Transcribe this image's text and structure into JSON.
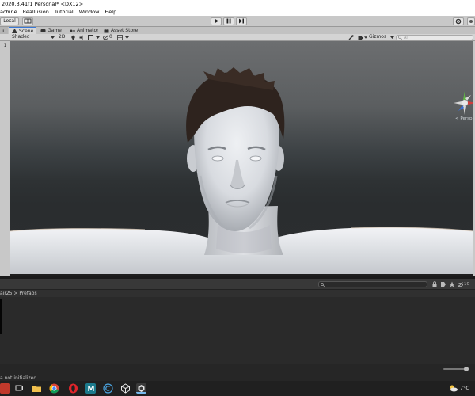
{
  "window": {
    "title": "2020.3.41f1 Personal* <DX12>"
  },
  "menu": {
    "items": [
      "achine",
      "Reallusion",
      "Tutorial",
      "Window",
      "Help"
    ]
  },
  "toolbar": {
    "pivot_label": "Local",
    "play_icon": "play-icon",
    "pause_icon": "pause-icon",
    "step_icon": "step-icon"
  },
  "tabs": [
    {
      "label": "Scene",
      "icon": "scene-icon"
    },
    {
      "label": "Game",
      "icon": "game-icon"
    },
    {
      "label": "Animator",
      "icon": "animator-icon"
    },
    {
      "label": "Asset Store",
      "icon": "store-icon"
    }
  ],
  "scene_toolbar": {
    "shading_mode": "Shaded",
    "mode_2d": "2D",
    "fx_count": "0",
    "gizmos_label": "Gizmos",
    "search_placeholder": "All"
  },
  "left_strip": {
    "number": "1"
  },
  "viewport": {
    "perspective_label": "< Persp"
  },
  "project": {
    "breadcrumb_parent": "air25",
    "breadcrumb_sep": ">",
    "breadcrumb_current": "Prefabs",
    "hidden_count": "10"
  },
  "status": {
    "message": "a not initialized"
  },
  "taskbar": {
    "temperature": "7°C"
  },
  "colors": {
    "unity_tab_accent": "#3a79d8",
    "viewport_bg": "#3c4144",
    "editor_dark": "#2a2a2a",
    "taskbar": "#202020"
  }
}
